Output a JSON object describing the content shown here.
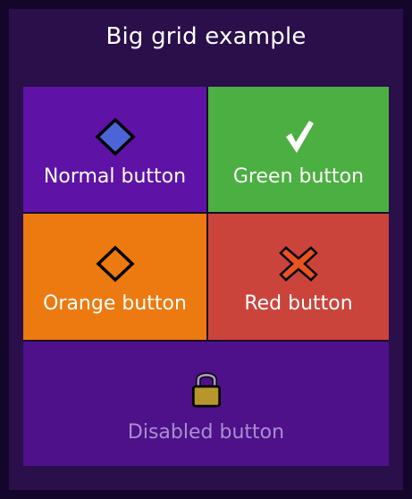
{
  "panel": {
    "title": "Big grid example"
  },
  "buttons": {
    "normal": {
      "label": "Normal button",
      "icon": "diamond-icon",
      "color": "#5e13a6"
    },
    "green": {
      "label": "Green button",
      "icon": "checkmark-icon",
      "color": "#4caf41"
    },
    "orange": {
      "label": "Orange button",
      "icon": "diamond-icon",
      "color": "#ec7a10"
    },
    "red": {
      "label": "Red button",
      "icon": "cross-icon",
      "color": "#cb443c"
    },
    "disabled": {
      "label": "Disabled button",
      "icon": "lock-icon",
      "color": "#4e118a",
      "disabled": true
    }
  }
}
